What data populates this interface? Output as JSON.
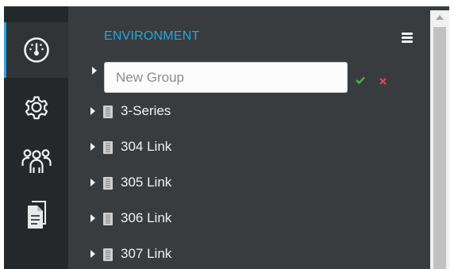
{
  "nav": {
    "items": [
      {
        "name": "dashboard",
        "icon": "gauge-icon",
        "active": true
      },
      {
        "name": "settings",
        "icon": "gear-icon",
        "active": false
      },
      {
        "name": "users",
        "icon": "users-icon",
        "active": false
      },
      {
        "name": "documents",
        "icon": "document-icon",
        "active": false
      }
    ]
  },
  "panel": {
    "title": "ENVIRONMENT",
    "menu_icon": "hamburger-menu-icon",
    "new_group": {
      "placeholder": "New Group",
      "value": "",
      "confirm_icon": "check-icon",
      "cancel_icon": "close-icon"
    },
    "tree": [
      {
        "label": "3-Series",
        "icon": "device-icon"
      },
      {
        "label": "304 Link",
        "icon": "device-icon"
      },
      {
        "label": "305 Link",
        "icon": "device-icon"
      },
      {
        "label": "306 Link",
        "icon": "device-icon"
      },
      {
        "label": "307 Link",
        "icon": "device-icon"
      }
    ]
  },
  "colors": {
    "accent": "#24a8de",
    "panel_bg": "#383c3f",
    "rail_bg": "#24282a",
    "confirm": "#43b649",
    "cancel": "#e0415d"
  }
}
